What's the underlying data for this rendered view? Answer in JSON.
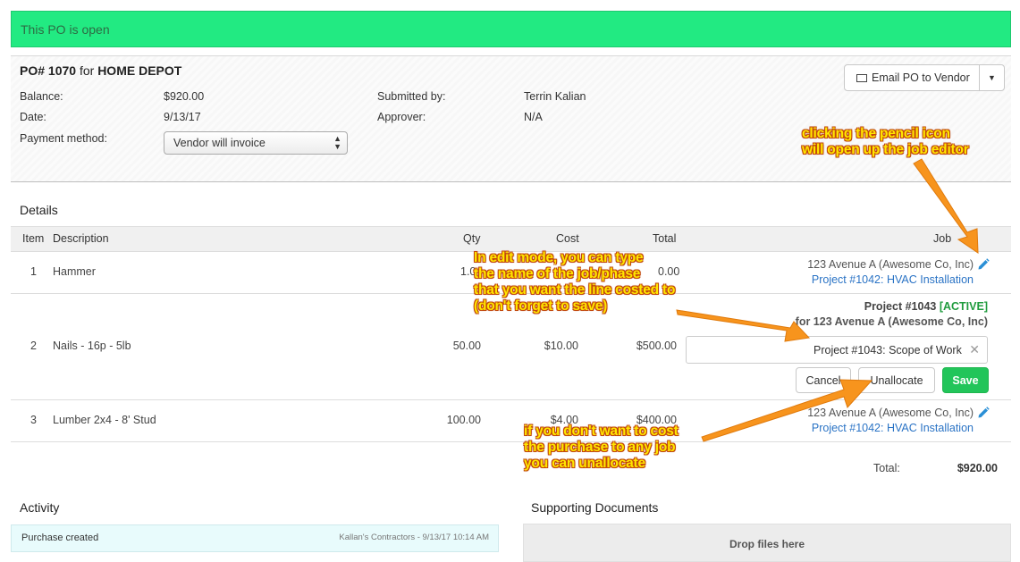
{
  "banner": {
    "text": "This PO is open"
  },
  "po": {
    "number": "PO# 1070",
    "for_word": "for",
    "vendor": "HOME DEPOT",
    "balance_label": "Balance:",
    "balance_value": "$920.00",
    "date_label": "Date:",
    "date_value": "9/13/17",
    "payment_label": "Payment method:",
    "payment_value": "Vendor will invoice",
    "submitted_label": "Submitted by:",
    "submitted_value": "Terrin Kalian",
    "approver_label": "Approver:",
    "approver_value": "N/A",
    "email_button": "Email PO to Vendor"
  },
  "details": {
    "title": "Details",
    "headers": {
      "item": "Item",
      "description": "Description",
      "qty": "Qty",
      "cost": "Cost",
      "total": "Total",
      "job": "Job"
    },
    "rows": [
      {
        "item": "1",
        "description": "Hammer",
        "qty": "1.0",
        "cost": "",
        "total": "0.00",
        "job_address": "123 Avenue A (Awesome Co, Inc)",
        "job_project": "Project #1042: HVAC Installation"
      },
      {
        "item": "2",
        "description": "Nails - 16p - 5lb",
        "qty": "50.00",
        "cost": "$10.00",
        "total": "$500.00",
        "edit_project": "Project #1043",
        "edit_status": "[ACTIVE]",
        "edit_for": "for 123 Avenue A (Awesome Co, Inc)",
        "edit_value": "Project #1043: Scope of Work",
        "cancel": "Cancel",
        "unallocate": "Unallocate",
        "save": "Save"
      },
      {
        "item": "3",
        "description": "Lumber 2x4 - 8' Stud",
        "qty": "100.00",
        "cost": "$4.00",
        "total": "$400.00",
        "job_address": "123 Avenue A (Awesome Co, Inc)",
        "job_project": "Project #1042: HVAC Installation"
      }
    ],
    "total_label": "Total:",
    "total_value": "$920.00"
  },
  "activity": {
    "title": "Activity",
    "items": [
      {
        "text": "Purchase created",
        "meta": "Kallan's Contractors - 9/13/17 10:14 AM"
      }
    ]
  },
  "documents": {
    "title": "Supporting Documents",
    "dropzone": "Drop files here"
  },
  "annotations": {
    "pencil": [
      "clicking the pencil icon",
      "will open up the job editor"
    ],
    "edit": [
      "In edit mode, you can type",
      "the name of the job/phase",
      "that you want the line costed to",
      "(don't forget to save)"
    ],
    "unallocate": [
      "if you don't want to cost",
      "the purchase to any job",
      "you can unallocate"
    ]
  },
  "colors": {
    "banner": "#22ea82",
    "link": "#2a73c5",
    "save": "#22c55a",
    "annotation_text": "#ffe600",
    "annotation_arrow": "#f7941d"
  }
}
